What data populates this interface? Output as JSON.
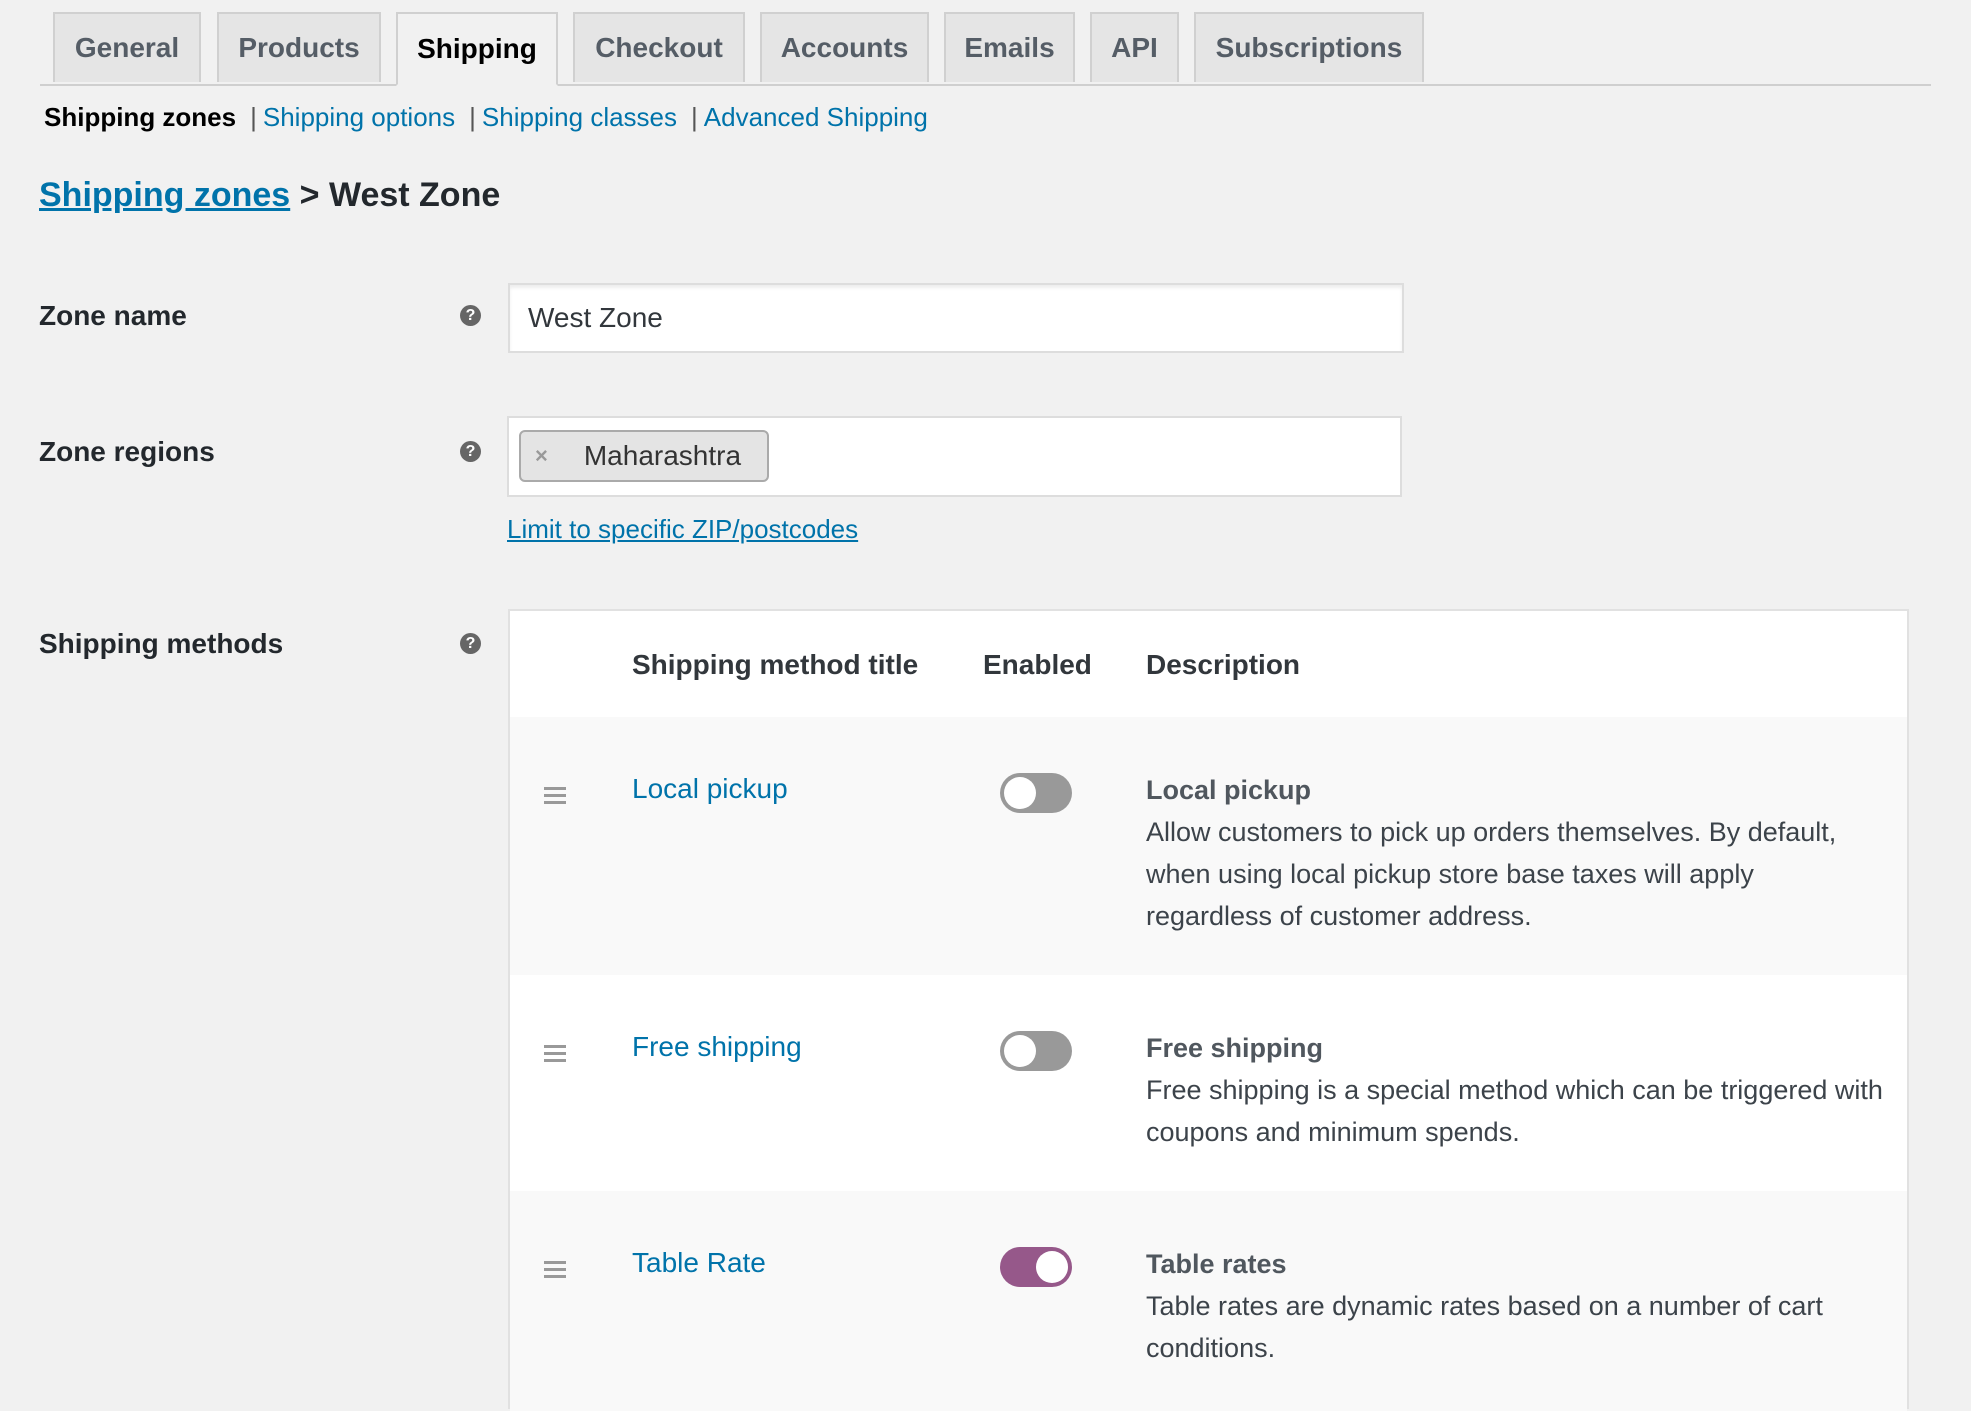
{
  "tabs": [
    {
      "label": "General",
      "active": false
    },
    {
      "label": "Products",
      "active": false
    },
    {
      "label": "Shipping",
      "active": true
    },
    {
      "label": "Checkout",
      "active": false
    },
    {
      "label": "Accounts",
      "active": false
    },
    {
      "label": "Emails",
      "active": false
    },
    {
      "label": "API",
      "active": false
    },
    {
      "label": "Subscriptions",
      "active": false
    }
  ],
  "subnav": {
    "current": "Shipping zones",
    "separator": "|",
    "links": [
      "Shipping options",
      "Shipping classes",
      "Advanced Shipping"
    ]
  },
  "breadcrumb": {
    "link": "Shipping zones",
    "rest": " > West Zone"
  },
  "form": {
    "zone_name_label": "Zone name",
    "zone_name_value": "West Zone",
    "zone_regions_label": "Zone regions",
    "regions": [
      "Maharashtra"
    ],
    "chip_remove": "×",
    "limit_link": "Limit to specific ZIP/postcodes",
    "shipping_methods_label": "Shipping methods",
    "help_glyph": "?"
  },
  "methods": {
    "headers": {
      "title": "Shipping method title",
      "enabled": "Enabled",
      "description": "Description"
    },
    "rows": [
      {
        "title": "Local pickup",
        "enabled": false,
        "desc_title": "Local pickup",
        "desc": "Allow customers to pick up orders themselves. By default, when using local pickup store base taxes will apply regardless of customer address."
      },
      {
        "title": "Free shipping",
        "enabled": false,
        "desc_title": "Free shipping",
        "desc": "Free shipping is a special method which can be triggered with coupons and minimum spends."
      },
      {
        "title": "Table Rate",
        "enabled": true,
        "desc_title": "Table rates",
        "desc": "Table rates are dynamic rates based on a number of cart conditions."
      }
    ]
  },
  "colors": {
    "link": "#0073aa",
    "toggle_on": "#96588a",
    "toggle_off": "#999999",
    "background": "#f1f1f1"
  },
  "icons": {
    "help": "help-circle-icon",
    "drag": "drag-handle-icon",
    "remove": "close-icon"
  }
}
